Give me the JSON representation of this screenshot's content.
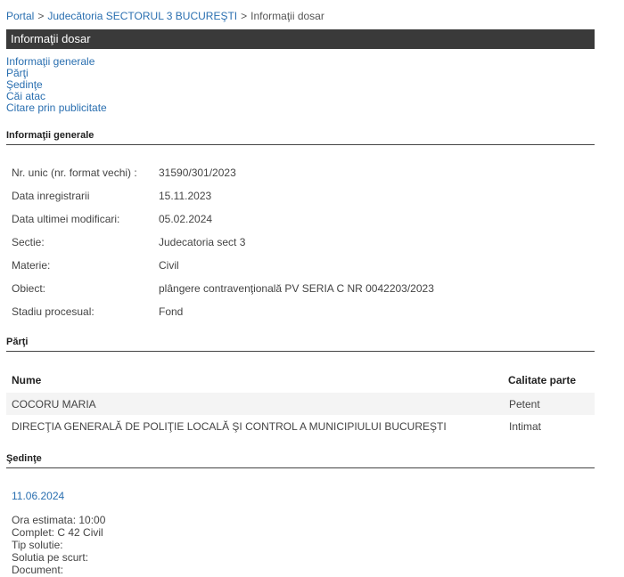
{
  "breadcrumb": {
    "items": [
      "Portal",
      "Judecătoria SECTORUL 3 BUCUREŞTI"
    ],
    "current": "Informaţii dosar",
    "separator": ">"
  },
  "title": "Informaţii dosar",
  "nav_links": [
    "Informaţii generale",
    "Părţi",
    "Şedinţe",
    "Căi atac",
    "Citare prin publicitate"
  ],
  "info_general": {
    "heading": "Informaţii generale",
    "rows": [
      {
        "label": "Nr. unic (nr. format vechi) :",
        "value": "31590/301/2023"
      },
      {
        "label": "Data inregistrarii",
        "value": "15.11.2023"
      },
      {
        "label": "Data ultimei modificari:",
        "value": "05.02.2024"
      },
      {
        "label": "Sectie:",
        "value": "Judecatoria sect 3"
      },
      {
        "label": "Materie:",
        "value": "Civil"
      },
      {
        "label": "Obiect:",
        "value": "plângere contravenţională PV SERIA C NR 0042203/2023"
      },
      {
        "label": "Stadiu procesual:",
        "value": "Fond"
      }
    ]
  },
  "parti": {
    "heading": "Părţi",
    "columns": [
      "Nume",
      "Calitate parte"
    ],
    "rows": [
      {
        "nume": "COCORU MARIA",
        "calitate": "Petent"
      },
      {
        "nume": "DIRECŢIA GENERALĂ DE POLIŢIE LOCALĂ ŞI CONTROL A MUNICIPIULUI BUCUREŞTI",
        "calitate": "Intimat"
      }
    ]
  },
  "sedinte": {
    "heading": "Şedinţe",
    "date": "11.06.2024",
    "details": [
      "Ora estimata: 10:00",
      "Complet: C 42 Civil",
      "Tip solutie:",
      "Solutia pe scurt:",
      "Document:"
    ]
  },
  "colors": {
    "link": "#2a6fb0",
    "titlebar": "#3a3a3a"
  }
}
